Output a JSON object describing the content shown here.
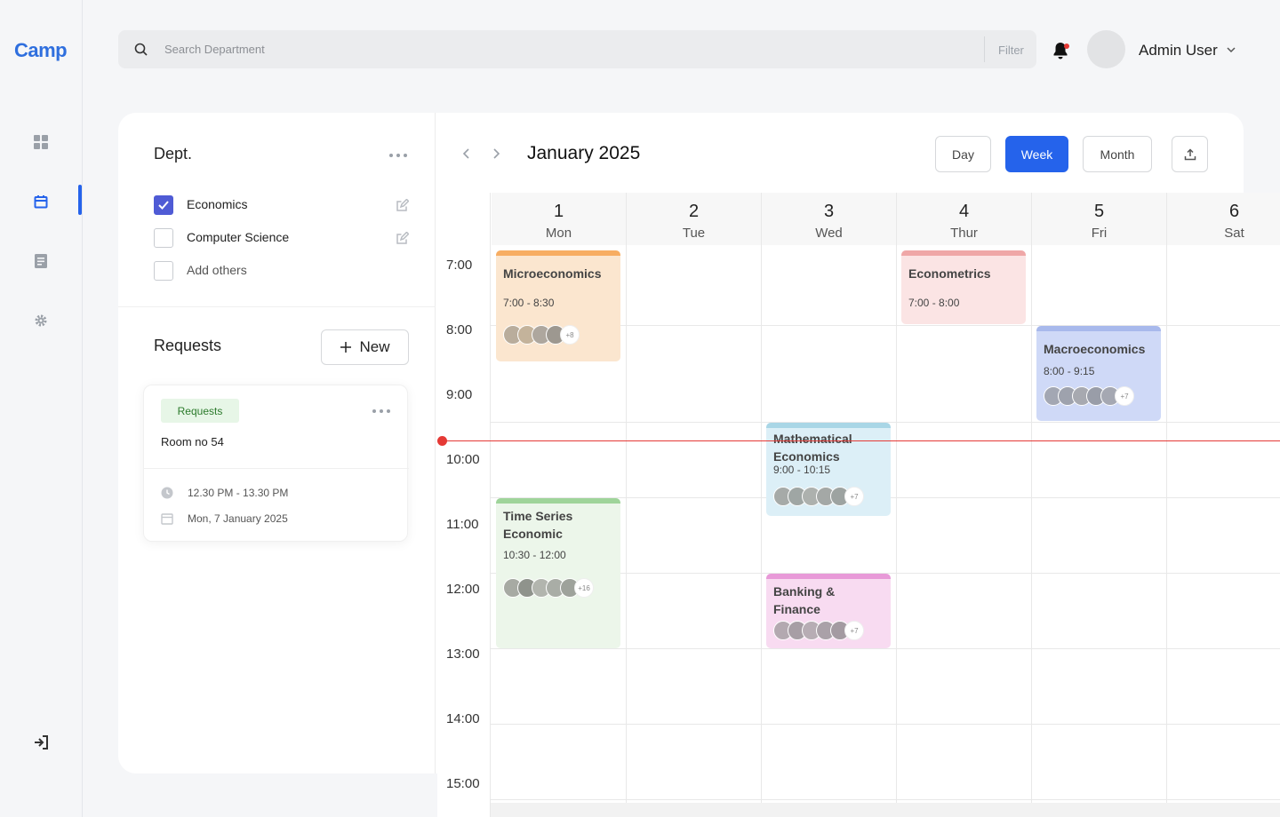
{
  "app": {
    "logo": "Camp"
  },
  "search": {
    "placeholder": "Search Department",
    "filter_label": "Filter"
  },
  "user": {
    "name": "Admin User"
  },
  "dept": {
    "title": "Dept.",
    "items": [
      {
        "label": "Economics",
        "checked": true
      },
      {
        "label": "Computer Science",
        "checked": false
      },
      {
        "label": "Add others",
        "checked": false
      }
    ]
  },
  "requests": {
    "title": "Requests",
    "new_label": "New",
    "card": {
      "badge": "Requests",
      "room": "Room no 54",
      "time": "12.30 PM - 13.30 PM",
      "date": "Mon, 7 January 2025"
    }
  },
  "calendar": {
    "month": "January 2025",
    "views": [
      "Day",
      "Week",
      "Month"
    ],
    "active_view": "Week",
    "days": [
      {
        "num": "1",
        "name": "Mon"
      },
      {
        "num": "2",
        "name": "Tue"
      },
      {
        "num": "3",
        "name": "Wed"
      },
      {
        "num": "4",
        "name": "Thur"
      },
      {
        "num": "5",
        "name": "Fri"
      },
      {
        "num": "6",
        "name": "Sat"
      }
    ],
    "times": [
      "7:00",
      "8:00",
      "9:00",
      "10:00",
      "11:00",
      "12:00",
      "13:00",
      "14:00",
      "15:00"
    ],
    "events": [
      {
        "title": "Microeconomics",
        "time": "7:00 - 8:30",
        "more": "+8"
      },
      {
        "title": "Econometrics",
        "time": "7:00 - 8:00"
      },
      {
        "title": "Macroeconomics",
        "time": "8:00 - 9:15",
        "more": "+7"
      },
      {
        "title": "Mathematical Economics",
        "time": "9:00 - 10:15",
        "more": "+7"
      },
      {
        "title": "Time Series Economic",
        "time": "10:30 - 12:00",
        "more": "+16"
      },
      {
        "title": "Banking & Finance",
        "more": "+7"
      }
    ]
  },
  "colors": {
    "accent": "#2563eb",
    "now_line": "#e53935",
    "micro": "#fbe6cf",
    "micro_border": "#f7ad62",
    "econometrics": "#fbe4e4",
    "econometrics_border": "#efa7a7",
    "macro": "#cfd9f7",
    "macro_border": "#a8b9ec",
    "math": "#dceff7",
    "math_border": "#a9d6e6",
    "timeseries": "#ecf6ea",
    "timeseries_border": "#9fd49a",
    "banking": "#f8dbf1",
    "banking_border": "#e89ad8"
  }
}
